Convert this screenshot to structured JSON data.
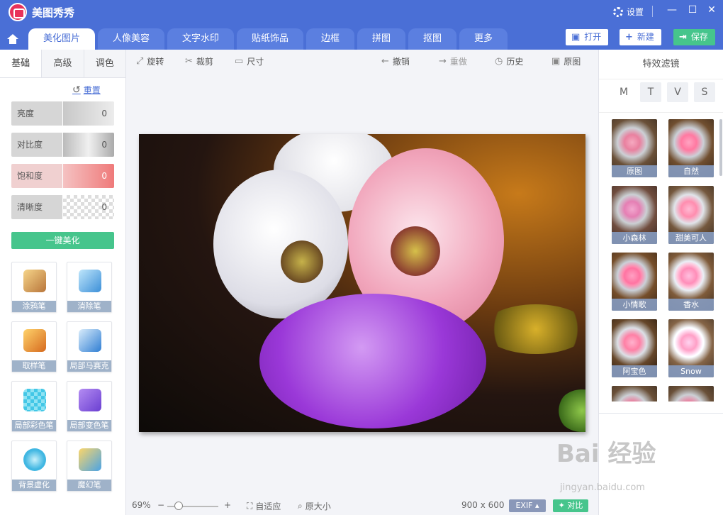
{
  "app": {
    "title": "美图秀秀",
    "settings": "设置"
  },
  "tabs": [
    "美化图片",
    "人像美容",
    "文字水印",
    "贴纸饰品",
    "边框",
    "拼图",
    "抠图",
    "更多"
  ],
  "header_buttons": {
    "open": "打开",
    "new": "新建",
    "save": "保存"
  },
  "left": {
    "tabs": [
      "基础",
      "高级",
      "调色"
    ],
    "reset": "重置",
    "sliders": [
      {
        "label": "亮度",
        "value": "0"
      },
      {
        "label": "对比度",
        "value": "0"
      },
      {
        "label": "饱和度",
        "value": "0"
      },
      {
        "label": "清晰度",
        "value": "0"
      }
    ],
    "one_key": "一键美化",
    "tools": [
      "涂鸦笔",
      "消除笔",
      "取样笔",
      "局部马赛克",
      "局部彩色笔",
      "局部变色笔",
      "背景虚化",
      "魔幻笔"
    ]
  },
  "toolbar": {
    "rotate": "旋转",
    "crop": "裁剪",
    "size": "尺寸",
    "undo": "撤销",
    "redo": "重做",
    "history": "历史",
    "original": "原图"
  },
  "status": {
    "zoom": "69%",
    "fit": "自适应",
    "actual": "原大小",
    "dimensions": "900 x 600",
    "exif": "EXIF",
    "compare": "对比"
  },
  "right": {
    "title": "特效滤镜",
    "categories": [
      "M",
      "T",
      "V",
      "S"
    ],
    "filters": [
      "原图",
      "自然",
      "小森林",
      "甜美可人",
      "小情歌",
      "香水",
      "阿宝色",
      "Snow"
    ]
  },
  "watermark": {
    "main": "Bai 经验",
    "sub": "jingyan.baidu.com"
  },
  "colors": {
    "primary": "#4a6fd6",
    "accent": "#46c58c"
  }
}
